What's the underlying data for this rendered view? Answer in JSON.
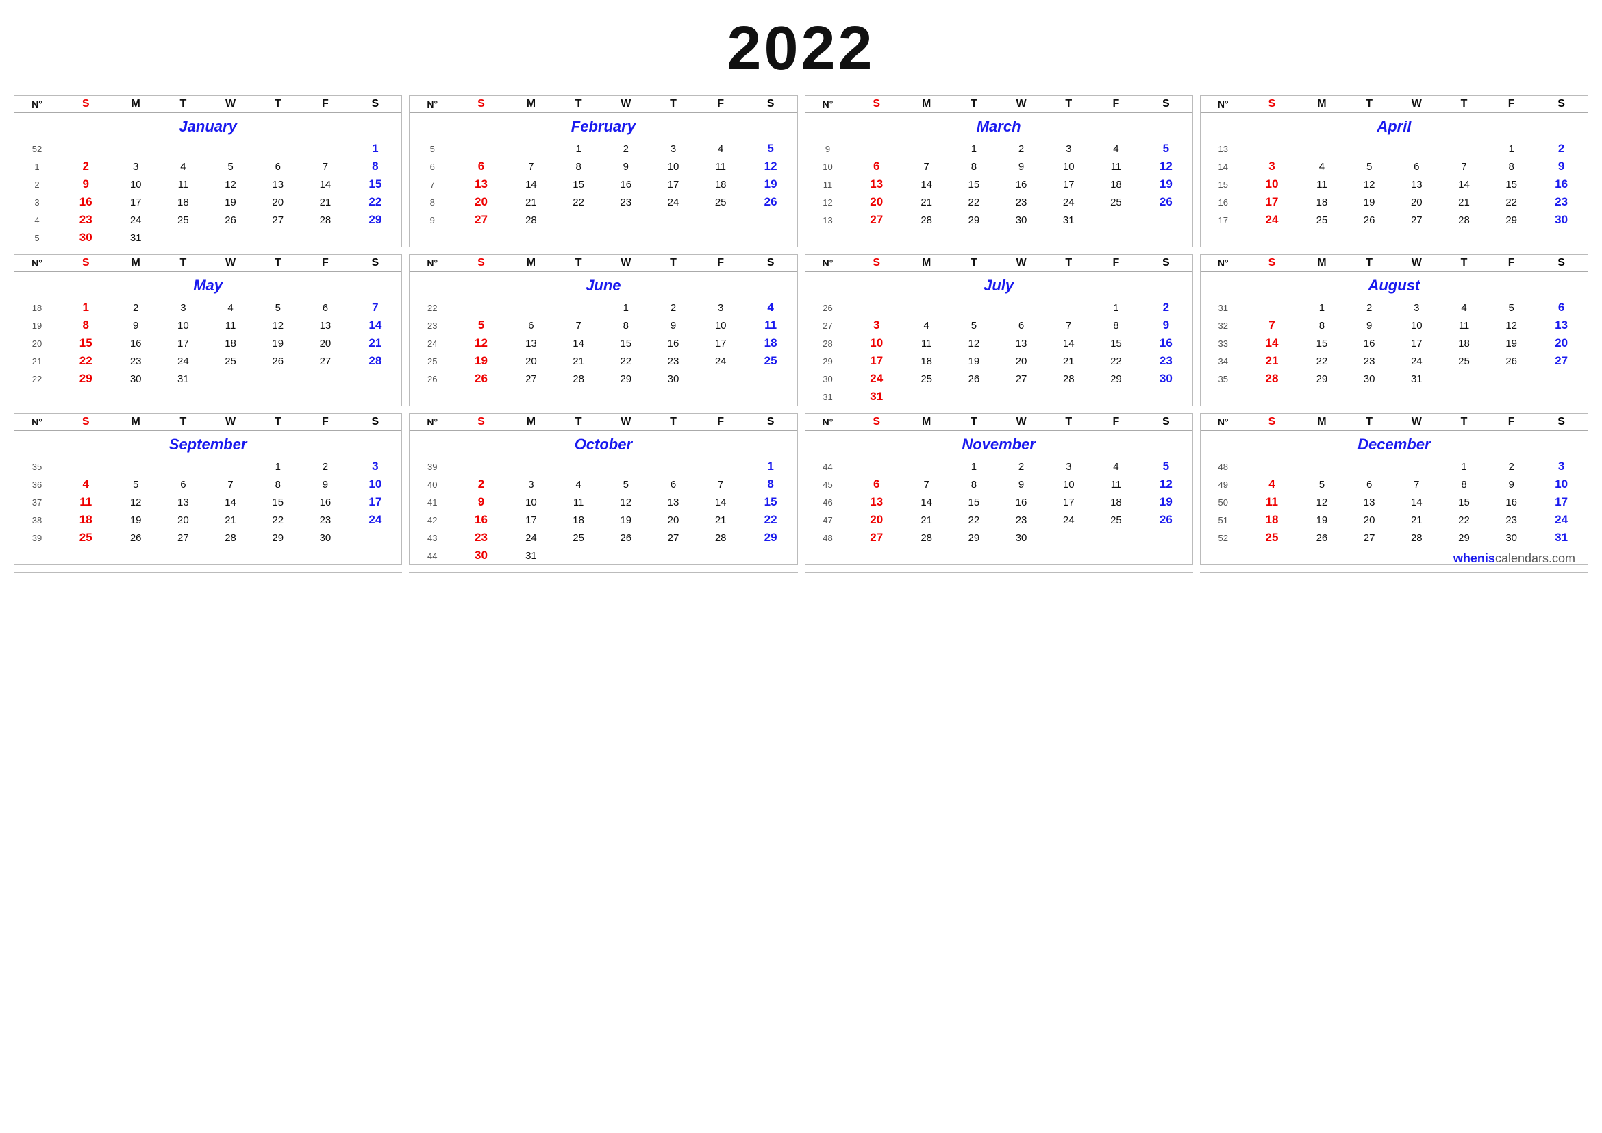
{
  "year": "2022",
  "watermark": "wheniscalendars.com",
  "months": [
    {
      "name": "January",
      "weeks": [
        {
          "num": "52",
          "days": [
            "",
            "",
            "",
            "",
            "",
            "",
            "1"
          ]
        },
        {
          "num": "1",
          "days": [
            "2",
            "3",
            "4",
            "5",
            "6",
            "7",
            "8"
          ]
        },
        {
          "num": "2",
          "days": [
            "9",
            "10",
            "11",
            "12",
            "13",
            "14",
            "15"
          ]
        },
        {
          "num": "3",
          "days": [
            "16",
            "17",
            "18",
            "19",
            "20",
            "21",
            "22"
          ]
        },
        {
          "num": "4",
          "days": [
            "23",
            "24",
            "25",
            "26",
            "27",
            "28",
            "29"
          ]
        },
        {
          "num": "5",
          "days": [
            "30",
            "31",
            "",
            "",
            "",
            "",
            ""
          ]
        }
      ]
    },
    {
      "name": "February",
      "weeks": [
        {
          "num": "5",
          "days": [
            "",
            "",
            "1",
            "2",
            "3",
            "4",
            "5"
          ]
        },
        {
          "num": "6",
          "days": [
            "6",
            "7",
            "8",
            "9",
            "10",
            "11",
            "12"
          ]
        },
        {
          "num": "7",
          "days": [
            "13",
            "14",
            "15",
            "16",
            "17",
            "18",
            "19"
          ]
        },
        {
          "num": "8",
          "days": [
            "20",
            "21",
            "22",
            "23",
            "24",
            "25",
            "26"
          ]
        },
        {
          "num": "9",
          "days": [
            "27",
            "28",
            "",
            "",
            "",
            "",
            ""
          ]
        }
      ]
    },
    {
      "name": "March",
      "weeks": [
        {
          "num": "9",
          "days": [
            "",
            "",
            "1",
            "2",
            "3",
            "4",
            "5"
          ]
        },
        {
          "num": "10",
          "days": [
            "6",
            "7",
            "8",
            "9",
            "10",
            "11",
            "12"
          ]
        },
        {
          "num": "11",
          "days": [
            "13",
            "14",
            "15",
            "16",
            "17",
            "18",
            "19"
          ]
        },
        {
          "num": "12",
          "days": [
            "20",
            "21",
            "22",
            "23",
            "24",
            "25",
            "26"
          ]
        },
        {
          "num": "13",
          "days": [
            "27",
            "28",
            "29",
            "30",
            "31",
            "",
            ""
          ]
        }
      ]
    },
    {
      "name": "April",
      "weeks": [
        {
          "num": "13",
          "days": [
            "",
            "",
            "",
            "",
            "",
            "1",
            "2"
          ]
        },
        {
          "num": "14",
          "days": [
            "3",
            "4",
            "5",
            "6",
            "7",
            "8",
            "9"
          ]
        },
        {
          "num": "15",
          "days": [
            "10",
            "11",
            "12",
            "13",
            "14",
            "15",
            "16"
          ]
        },
        {
          "num": "16",
          "days": [
            "17",
            "18",
            "19",
            "20",
            "21",
            "22",
            "23"
          ]
        },
        {
          "num": "17",
          "days": [
            "24",
            "25",
            "26",
            "27",
            "28",
            "29",
            "30"
          ]
        }
      ]
    },
    {
      "name": "May",
      "weeks": [
        {
          "num": "18",
          "days": [
            "1",
            "2",
            "3",
            "4",
            "5",
            "6",
            "7"
          ]
        },
        {
          "num": "19",
          "days": [
            "8",
            "9",
            "10",
            "11",
            "12",
            "13",
            "14"
          ]
        },
        {
          "num": "20",
          "days": [
            "15",
            "16",
            "17",
            "18",
            "19",
            "20",
            "21"
          ]
        },
        {
          "num": "21",
          "days": [
            "22",
            "23",
            "24",
            "25",
            "26",
            "27",
            "28"
          ]
        },
        {
          "num": "22",
          "days": [
            "29",
            "30",
            "31",
            "",
            "",
            "",
            ""
          ]
        }
      ]
    },
    {
      "name": "June",
      "weeks": [
        {
          "num": "22",
          "days": [
            "",
            "",
            "",
            "1",
            "2",
            "3",
            "4"
          ]
        },
        {
          "num": "23",
          "days": [
            "5",
            "6",
            "7",
            "8",
            "9",
            "10",
            "11"
          ]
        },
        {
          "num": "24",
          "days": [
            "12",
            "13",
            "14",
            "15",
            "16",
            "17",
            "18"
          ]
        },
        {
          "num": "25",
          "days": [
            "19",
            "20",
            "21",
            "22",
            "23",
            "24",
            "25"
          ]
        },
        {
          "num": "26",
          "days": [
            "26",
            "27",
            "28",
            "29",
            "30",
            "",
            ""
          ]
        }
      ]
    },
    {
      "name": "July",
      "weeks": [
        {
          "num": "26",
          "days": [
            "",
            "",
            "",
            "",
            "",
            "1",
            "2"
          ]
        },
        {
          "num": "27",
          "days": [
            "3",
            "4",
            "5",
            "6",
            "7",
            "8",
            "9"
          ]
        },
        {
          "num": "28",
          "days": [
            "10",
            "11",
            "12",
            "13",
            "14",
            "15",
            "16"
          ]
        },
        {
          "num": "29",
          "days": [
            "17",
            "18",
            "19",
            "20",
            "21",
            "22",
            "23"
          ]
        },
        {
          "num": "30",
          "days": [
            "24",
            "25",
            "26",
            "27",
            "28",
            "29",
            "30"
          ]
        },
        {
          "num": "31",
          "days": [
            "31",
            "",
            "",
            "",
            "",
            "",
            ""
          ]
        }
      ]
    },
    {
      "name": "August",
      "weeks": [
        {
          "num": "31",
          "days": [
            "",
            "1",
            "2",
            "3",
            "4",
            "5",
            "6"
          ]
        },
        {
          "num": "32",
          "days": [
            "7",
            "8",
            "9",
            "10",
            "11",
            "12",
            "13"
          ]
        },
        {
          "num": "33",
          "days": [
            "14",
            "15",
            "16",
            "17",
            "18",
            "19",
            "20"
          ]
        },
        {
          "num": "34",
          "days": [
            "21",
            "22",
            "23",
            "24",
            "25",
            "26",
            "27"
          ]
        },
        {
          "num": "35",
          "days": [
            "28",
            "29",
            "30",
            "31",
            "",
            "",
            ""
          ]
        }
      ]
    },
    {
      "name": "September",
      "weeks": [
        {
          "num": "35",
          "days": [
            "",
            "",
            "",
            "",
            "1",
            "2",
            "3"
          ]
        },
        {
          "num": "36",
          "days": [
            "4",
            "5",
            "6",
            "7",
            "8",
            "9",
            "10"
          ]
        },
        {
          "num": "37",
          "days": [
            "11",
            "12",
            "13",
            "14",
            "15",
            "16",
            "17"
          ]
        },
        {
          "num": "38",
          "days": [
            "18",
            "19",
            "20",
            "21",
            "22",
            "23",
            "24"
          ]
        },
        {
          "num": "39",
          "days": [
            "25",
            "26",
            "27",
            "28",
            "29",
            "30",
            ""
          ]
        }
      ]
    },
    {
      "name": "October",
      "weeks": [
        {
          "num": "39",
          "days": [
            "",
            "",
            "",
            "",
            "",
            "",
            "1"
          ]
        },
        {
          "num": "40",
          "days": [
            "2",
            "3",
            "4",
            "5",
            "6",
            "7",
            "8"
          ]
        },
        {
          "num": "41",
          "days": [
            "9",
            "10",
            "11",
            "12",
            "13",
            "14",
            "15"
          ]
        },
        {
          "num": "42",
          "days": [
            "16",
            "17",
            "18",
            "19",
            "20",
            "21",
            "22"
          ]
        },
        {
          "num": "43",
          "days": [
            "23",
            "24",
            "25",
            "26",
            "27",
            "28",
            "29"
          ]
        },
        {
          "num": "44",
          "days": [
            "30",
            "31",
            "",
            "",
            "",
            "",
            ""
          ]
        }
      ]
    },
    {
      "name": "November",
      "weeks": [
        {
          "num": "44",
          "days": [
            "",
            "",
            "1",
            "2",
            "3",
            "4",
            "5"
          ]
        },
        {
          "num": "45",
          "days": [
            "6",
            "7",
            "8",
            "9",
            "10",
            "11",
            "12"
          ]
        },
        {
          "num": "46",
          "days": [
            "13",
            "14",
            "15",
            "16",
            "17",
            "18",
            "19"
          ]
        },
        {
          "num": "47",
          "days": [
            "20",
            "21",
            "22",
            "23",
            "24",
            "25",
            "26"
          ]
        },
        {
          "num": "48",
          "days": [
            "27",
            "28",
            "29",
            "30",
            "",
            "",
            ""
          ]
        }
      ]
    },
    {
      "name": "December",
      "weeks": [
        {
          "num": "48",
          "days": [
            "",
            "",
            "",
            "",
            "1",
            "2",
            "3"
          ]
        },
        {
          "num": "49",
          "days": [
            "4",
            "5",
            "6",
            "7",
            "8",
            "9",
            "10"
          ]
        },
        {
          "num": "50",
          "days": [
            "11",
            "12",
            "13",
            "14",
            "15",
            "16",
            "17"
          ]
        },
        {
          "num": "51",
          "days": [
            "18",
            "19",
            "20",
            "21",
            "22",
            "23",
            "24"
          ]
        },
        {
          "num": "52",
          "days": [
            "25",
            "26",
            "27",
            "28",
            "29",
            "30",
            "31"
          ]
        }
      ]
    }
  ],
  "day_headers": [
    "N°",
    "S",
    "M",
    "T",
    "W",
    "T",
    "F",
    "S"
  ]
}
